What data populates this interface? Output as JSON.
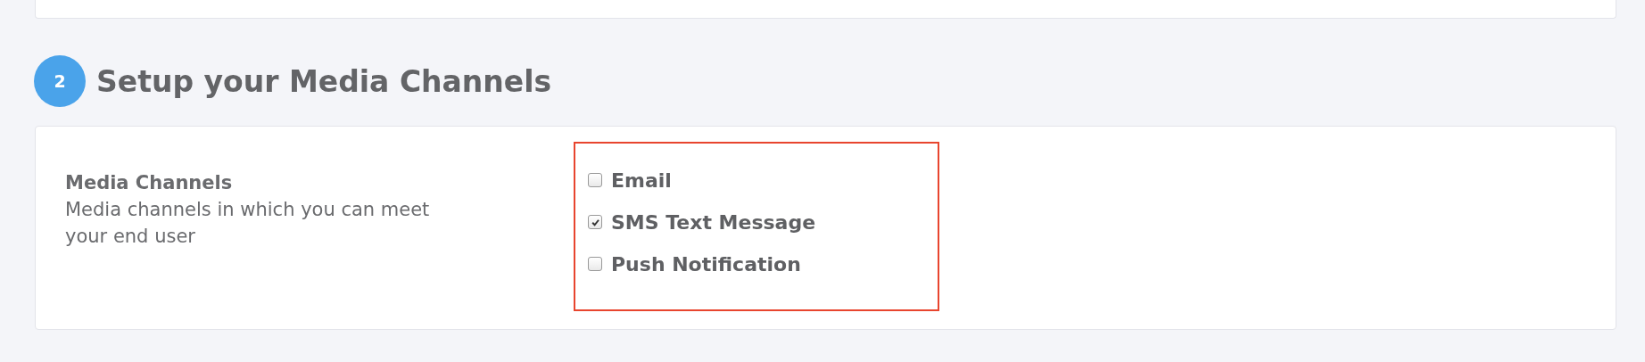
{
  "step": {
    "number": "2",
    "title": "Setup your Media Channels"
  },
  "field": {
    "label": "Media Channels",
    "description": "Media channels in which you can meet your end user"
  },
  "options": [
    {
      "label": "Email",
      "checked": false
    },
    {
      "label": "SMS Text Message",
      "checked": true
    },
    {
      "label": "Push Notification",
      "checked": false
    }
  ]
}
